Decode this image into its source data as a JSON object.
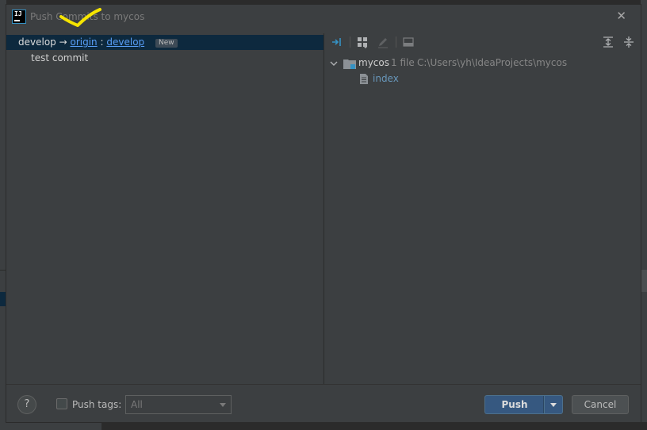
{
  "dialog": {
    "title": "Push Commits to mycos",
    "icon": "intellij-idea-icon",
    "close_glyph": "✕"
  },
  "branch": {
    "local": "develop",
    "arrow": "→",
    "remote": "origin",
    "sep": ":",
    "target": "develop",
    "badge": "New"
  },
  "commits": [
    {
      "message": "test commit"
    }
  ],
  "toolbar": {
    "icons": [
      "show-diff-icon",
      "group-by-icon",
      "edit-source-icon",
      "commit-details-icon",
      "expand-all-icon",
      "collapse-all-icon"
    ]
  },
  "tree": {
    "root": {
      "name": "mycos",
      "count": "1 file",
      "path": "C:\\Users\\yh\\IdeaProjects\\mycos"
    },
    "files": [
      {
        "name": "index"
      }
    ]
  },
  "footer": {
    "help": "?",
    "push_tags_label": "Push tags:",
    "tags_select_value": "All",
    "push_label": "Push",
    "cancel_label": "Cancel"
  },
  "colors": {
    "accent": "#365880",
    "selection": "#0d293e",
    "link": "#589df6",
    "annotation": "#f5e400"
  }
}
